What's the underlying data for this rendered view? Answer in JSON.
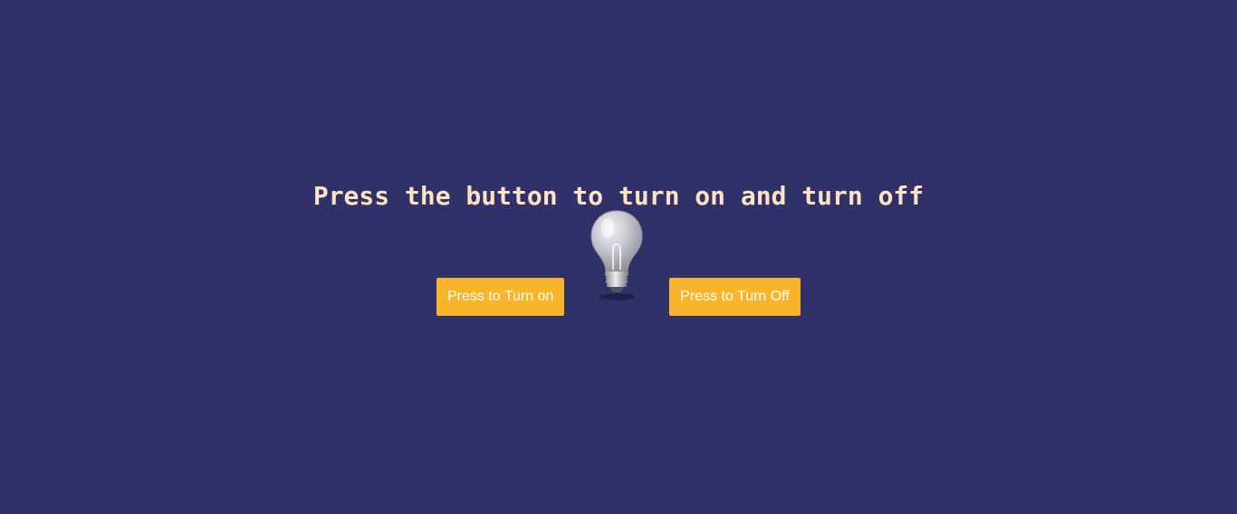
{
  "heading": "Press the button to turn on and turn off",
  "buttons": {
    "turn_on_label": "Press to Turn on",
    "turn_off_label": "Press to Turn Off"
  },
  "bulb": {
    "icon": "lightbulb-icon",
    "state": "off"
  },
  "colors": {
    "background": "#31316a",
    "heading": "#fde2c3",
    "button": "#f8b52b",
    "button_text": "#ffffff"
  }
}
